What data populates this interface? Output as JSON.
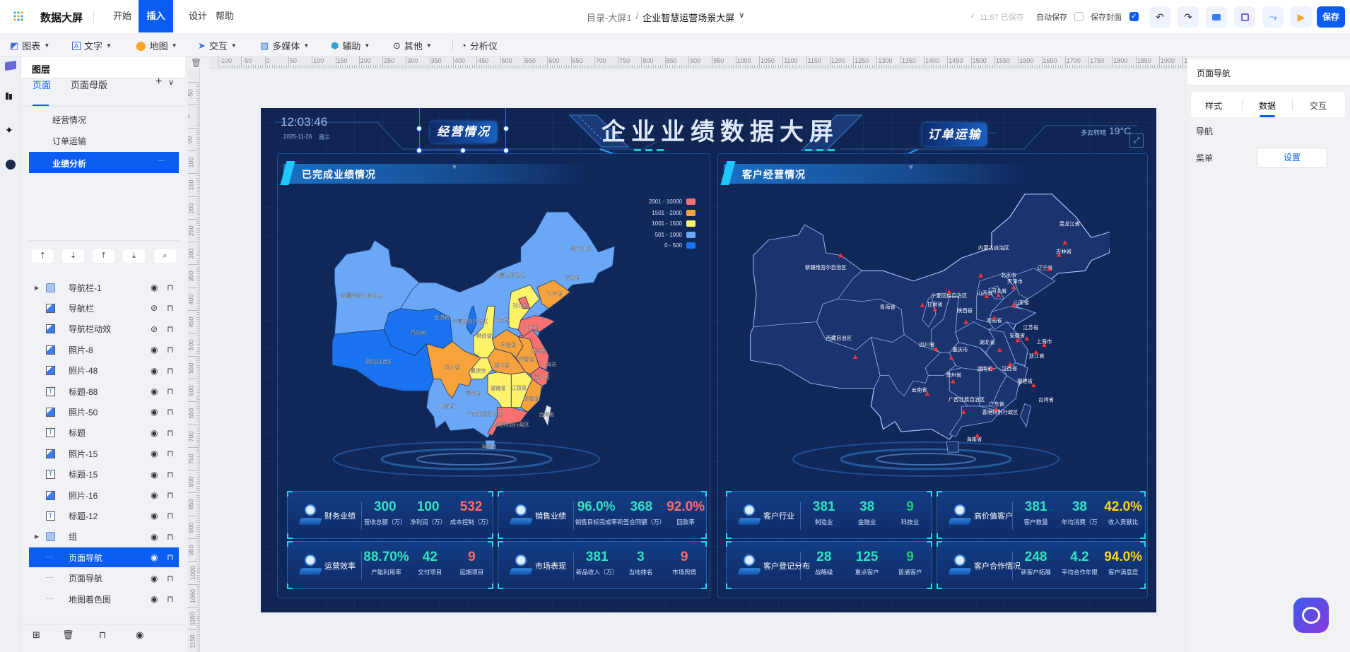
{
  "app": {
    "name": "数据大屏",
    "menu": [
      "开始",
      "插入",
      "设计",
      "帮助"
    ],
    "active_menu": "插入"
  },
  "breadcrumb": {
    "root": "目录-大屏1",
    "separator": "/",
    "current": "企业智慧运营场景大屏",
    "chevron": "∨"
  },
  "status": {
    "saved": "11:57 已保存",
    "autosave_label": "自动保存",
    "autosave_checked": false,
    "save_cover_label": "保存封面",
    "save_cover_checked": true,
    "save_label": "保存"
  },
  "header_icons": [
    "undo-icon",
    "redo-icon",
    "preview-screen-icon",
    "fullscreen-icon",
    "share-icon",
    "play-icon"
  ],
  "toolbar": [
    {
      "label": "图表",
      "icon": "chart-icon",
      "dropdown": true
    },
    {
      "label": "文字",
      "icon": "text-icon",
      "dropdown": true
    },
    {
      "label": "地图",
      "icon": "map-pin-icon",
      "dropdown": true
    },
    {
      "label": "交互",
      "icon": "cursor-icon",
      "dropdown": true
    },
    {
      "label": "多媒体",
      "icon": "image-icon",
      "dropdown": true
    },
    {
      "label": "辅助",
      "icon": "connector-icon",
      "dropdown": true
    },
    {
      "label": "其他",
      "icon": "more-circle-icon",
      "dropdown": true
    },
    {
      "label": "分析仪",
      "icon": "pie-icon",
      "dropdown": false
    }
  ],
  "ruler": {
    "horizontal": [
      "-100",
      "-50",
      "0",
      "50",
      "100",
      "150",
      "200",
      "250",
      "300",
      "350",
      "400",
      "450",
      "500",
      "550",
      "600",
      "650",
      "700",
      "750",
      "800",
      "850",
      "900",
      "950",
      "1000",
      "1050",
      "1100",
      "1150",
      "1200",
      "1250",
      "1300",
      "1350",
      "1400",
      "1450",
      "1500",
      "1550",
      "1600",
      "1650",
      "1700",
      "1750",
      "1800",
      "1850",
      "1900",
      "1950"
    ],
    "vertical": [
      "-50",
      "0",
      "50",
      "100",
      "150",
      "200",
      "250",
      "300",
      "350",
      "400",
      "450",
      "500",
      "550",
      "600",
      "650",
      "700",
      "750",
      "800",
      "850",
      "900",
      "950",
      "1000",
      "1050",
      "1100",
      "1150"
    ]
  },
  "layers_panel": {
    "title": "图层",
    "tabs": [
      "页面",
      "页面母版"
    ],
    "active_tab": "页面",
    "add": "+",
    "pages": [
      "经营情况",
      "订单运输",
      "业绩分析"
    ],
    "selected_page": "业绩分析",
    "page_more": "···",
    "layers": [
      {
        "name": "导航栏-1",
        "type": "group",
        "visible": true
      },
      {
        "name": "导航栏",
        "type": "image",
        "visible": false
      },
      {
        "name": "导航栏动效",
        "type": "image",
        "visible": false
      },
      {
        "name": "照片-8",
        "type": "image",
        "visible": true
      },
      {
        "name": "照片-48",
        "type": "image",
        "visible": true
      },
      {
        "name": "标题-88",
        "type": "text",
        "visible": true
      },
      {
        "name": "照片-50",
        "type": "image",
        "visible": true
      },
      {
        "name": "标题",
        "type": "text",
        "visible": true
      },
      {
        "name": "照片-15",
        "type": "image",
        "visible": true
      },
      {
        "name": "标题-15",
        "type": "text",
        "visible": true
      },
      {
        "name": "照片-16",
        "type": "image",
        "visible": true
      },
      {
        "name": "标题-12",
        "type": "text",
        "visible": true
      },
      {
        "name": "组",
        "type": "group",
        "visible": true
      },
      {
        "name": "页面导航",
        "type": "component",
        "visible": true,
        "selected": true
      },
      {
        "name": "页面导航",
        "type": "component",
        "visible": true
      },
      {
        "name": "地图着色图",
        "type": "component",
        "visible": true
      }
    ]
  },
  "right_panel": {
    "title": "页面导航",
    "tabs": [
      "样式",
      "数据",
      "交互"
    ],
    "active_tab": "数据",
    "section": "导航",
    "menu_label": "菜单",
    "menu_button": "设置"
  },
  "dashboard": {
    "time": "12:03:46",
    "date": "2025-11-26",
    "weekday": "周三",
    "title": "企业业绩数据大屏",
    "nav_left": "经营情况",
    "nav_right": "订单运输",
    "weather": "多云转晴",
    "temperature": "19°C",
    "left_panel_title": "已完成业绩情况",
    "right_panel_title": "客户经营情况",
    "colors": {
      "teal": "#2fe3c2",
      "red": "#ff6b6b",
      "yellow": "#ffd21f",
      "green": "#22c97a"
    },
    "legend": [
      {
        "label": "2001 - 10000",
        "color": "#f87171"
      },
      {
        "label": "1501 - 2000",
        "color": "#f7a23b"
      },
      {
        "label": "1001 - 1500",
        "color": "#fff36a"
      },
      {
        "label": "501 - 1000",
        "color": "#6aa8f7"
      },
      {
        "label": "0 - 500",
        "color": "#1a73f0"
      }
    ],
    "left_map_labels": [
      "黑龙江省",
      "吉林省",
      "内蒙古自治区",
      "辽宁省",
      "新疆维吾尔自治区",
      "河北省",
      "甘肃省",
      "宁夏回族自治区",
      "山西省",
      "山东省",
      "青海省",
      "陕西省",
      "河南省",
      "江苏省",
      "安徽省",
      "西藏自治区",
      "四川省",
      "湖北省",
      "重庆市",
      "上海市",
      "浙江省",
      "湖南省",
      "江西省",
      "贵州省",
      "福建省",
      "云南省",
      "广西壮族自治区",
      "台湾省",
      "香港特别行政区",
      "海南省"
    ],
    "right_map_labels": [
      "黑龙江省",
      "吉林省",
      "内蒙古自治区",
      "辽宁省",
      "新疆维吾尔自治区",
      "北京市",
      "天津市",
      "宁夏回族自治区",
      "山西省",
      "河北省",
      "山东省",
      "青海省",
      "甘肃省",
      "陕西省",
      "河南省",
      "江苏省",
      "安徽省",
      "上海市",
      "湖北省",
      "西藏自治区",
      "四川省",
      "重庆市",
      "浙江省",
      "湖南省",
      "江西省",
      "贵州省",
      "福建省",
      "云南省",
      "广西壮族自治区",
      "广东省",
      "香港特别行政区",
      "台湾省",
      "海南省"
    ],
    "cards": [
      {
        "label": "财务业绩",
        "icon": "gauge-icon",
        "metrics": [
          {
            "value": "300",
            "label": "营收总额（万）",
            "color": "teal"
          },
          {
            "value": "100",
            "label": "净利润（万）",
            "color": "teal"
          },
          {
            "value": "532",
            "label": "成本控制（万）",
            "color": "red"
          }
        ]
      },
      {
        "label": "销售业绩",
        "icon": "badge-icon",
        "metrics": [
          {
            "value": "96.0%",
            "label": "销售目标完成率",
            "color": "teal"
          },
          {
            "value": "368",
            "label": "新签合同额（万）",
            "color": "teal"
          },
          {
            "value": "92.0%",
            "label": "回款率",
            "color": "red"
          }
        ]
      },
      {
        "label": "运营效率",
        "icon": "calculator-icon",
        "metrics": [
          {
            "value": "88.70%",
            "label": "产能利用率",
            "color": "teal"
          },
          {
            "value": "42",
            "label": "交付项目",
            "color": "teal"
          },
          {
            "value": "9",
            "label": "延期项目",
            "color": "red"
          }
        ]
      },
      {
        "label": "市场表现",
        "icon": "user-icon",
        "metrics": [
          {
            "value": "381",
            "label": "新品收入（万）",
            "color": "teal"
          },
          {
            "value": "3",
            "label": "当地排名",
            "color": "teal"
          },
          {
            "value": "9",
            "label": "市场舆情",
            "color": "red"
          }
        ]
      },
      {
        "label": "客户行业",
        "icon": "gauge-icon",
        "metrics": [
          {
            "value": "381",
            "label": "制造业",
            "color": "teal"
          },
          {
            "value": "38",
            "label": "金融业",
            "color": "teal"
          },
          {
            "value": "9",
            "label": "科技业",
            "color": "green"
          }
        ]
      },
      {
        "label": "高价值客户",
        "icon": "badge-icon",
        "metrics": [
          {
            "value": "381",
            "label": "客户数量",
            "color": "teal"
          },
          {
            "value": "38",
            "label": "年均消费（万",
            "color": "teal"
          },
          {
            "value": "42.0%",
            "label": "收入贡献比",
            "color": "yellow"
          }
        ]
      },
      {
        "label": "客户登记分布",
        "icon": "calculator-icon",
        "metrics": [
          {
            "value": "28",
            "label": "战略级",
            "color": "teal"
          },
          {
            "value": "125",
            "label": "重点客户",
            "color": "teal"
          },
          {
            "value": "9",
            "label": "普通客户",
            "color": "green"
          }
        ]
      },
      {
        "label": "客户合作情况",
        "icon": "user-icon",
        "metrics": [
          {
            "value": "248",
            "label": "新客户拓展",
            "color": "teal"
          },
          {
            "value": "4.2",
            "label": "平均合作年限",
            "color": "teal"
          },
          {
            "value": "94.0%",
            "label": "客户满意度",
            "color": "yellow"
          }
        ]
      }
    ]
  }
}
